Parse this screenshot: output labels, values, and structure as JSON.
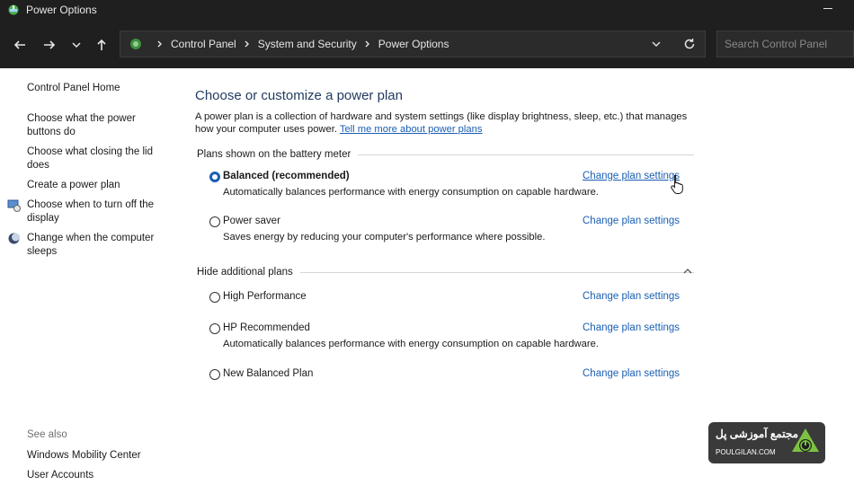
{
  "window": {
    "title": "Power Options"
  },
  "nav": {
    "breadcrumbs": [
      "Control Panel",
      "System and Security",
      "Power Options"
    ],
    "search_placeholder": "Search Control Panel"
  },
  "sidebar": {
    "items": [
      {
        "label": "Control Panel Home"
      },
      {
        "label": "Choose what the power buttons do"
      },
      {
        "label": "Choose what closing the lid does"
      },
      {
        "label": "Create a power plan"
      },
      {
        "label": "Choose when to turn off the display"
      },
      {
        "label": "Change when the computer sleeps"
      }
    ],
    "see_also": "See also",
    "see_also_items": [
      {
        "label": "Windows Mobility Center"
      },
      {
        "label": "User Accounts"
      }
    ]
  },
  "main": {
    "heading": "Choose or customize a power plan",
    "description": "A power plan is a collection of hardware and system settings (like display brightness, sleep, etc.) that manages how your computer uses power.",
    "learn_more": "Tell me more about power plans",
    "section_battery": "Plans shown on the battery meter",
    "section_additional": "Hide additional plans",
    "change_label": "Change plan settings",
    "plans": [
      {
        "name": "Balanced (recommended)",
        "desc": "Automatically balances performance with energy consumption on capable hardware.",
        "selected": true
      },
      {
        "name": "Power saver",
        "desc": "Saves energy by reducing your computer's performance where possible.",
        "selected": false
      },
      {
        "name": "High Performance",
        "desc": "",
        "selected": false
      },
      {
        "name": "HP Recommended",
        "desc": "Automatically balances performance with energy consumption on capable hardware.",
        "selected": false
      },
      {
        "name": "New Balanced Plan",
        "desc": "",
        "selected": false
      }
    ]
  },
  "watermark": {
    "text": "مجتمع آموزشی پل",
    "sub": "POULGILAN.COM"
  },
  "colors": {
    "accent": "#1a5fb4",
    "titlebar": "#1f1f1f",
    "heading": "#1e3a5f"
  }
}
